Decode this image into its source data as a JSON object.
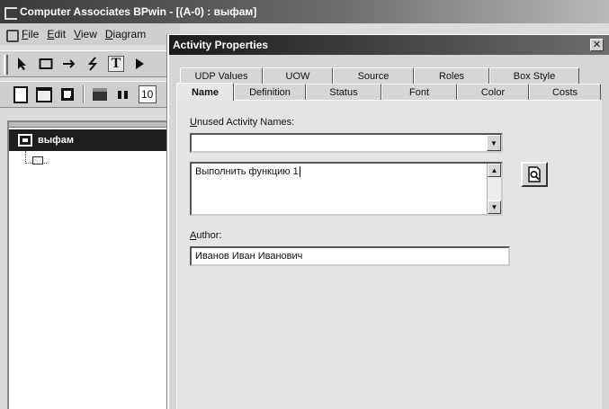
{
  "main_window": {
    "title": "Computer Associates BPwin - [(A-0) : выфам]"
  },
  "menu": {
    "items": [
      {
        "key": "F",
        "rest": "ile"
      },
      {
        "key": "E",
        "rest": "dit"
      },
      {
        "key": "V",
        "rest": "iew"
      },
      {
        "key": "D",
        "rest": "iagram"
      }
    ]
  },
  "toolbar": {
    "pointer_tool": "pointer-icon",
    "box_tool": "box-icon",
    "arrow_tool": "arrow-icon",
    "squiggle_tool": "squiggle-icon",
    "text_tool": "T",
    "play_tool": "triangle-icon",
    "zoom_value": "10"
  },
  "explorer": {
    "root_label": "выфам"
  },
  "dialog": {
    "title": "Activity Properties",
    "close_glyph": "✕",
    "tabs_back": [
      "UDP Values",
      "UOW",
      "Source",
      "Roles",
      "Box Style"
    ],
    "tabs_front": [
      "Name",
      "Definition",
      "Status",
      "Font",
      "Color",
      "Costs"
    ],
    "active_tab": "Name",
    "unused_names_label": {
      "key": "U",
      "rest": "nused Activity Names:"
    },
    "unused_names_value": "",
    "name_text": "Выполнить функцию 1",
    "author_label": {
      "key": "A",
      "rest": "uthor:"
    },
    "author_value": "Иванов Иван Иванович"
  },
  "colors": {
    "title_dark": "#1c1c1c",
    "panel": "#e4e4e4",
    "selection": "#1e1e1e"
  }
}
